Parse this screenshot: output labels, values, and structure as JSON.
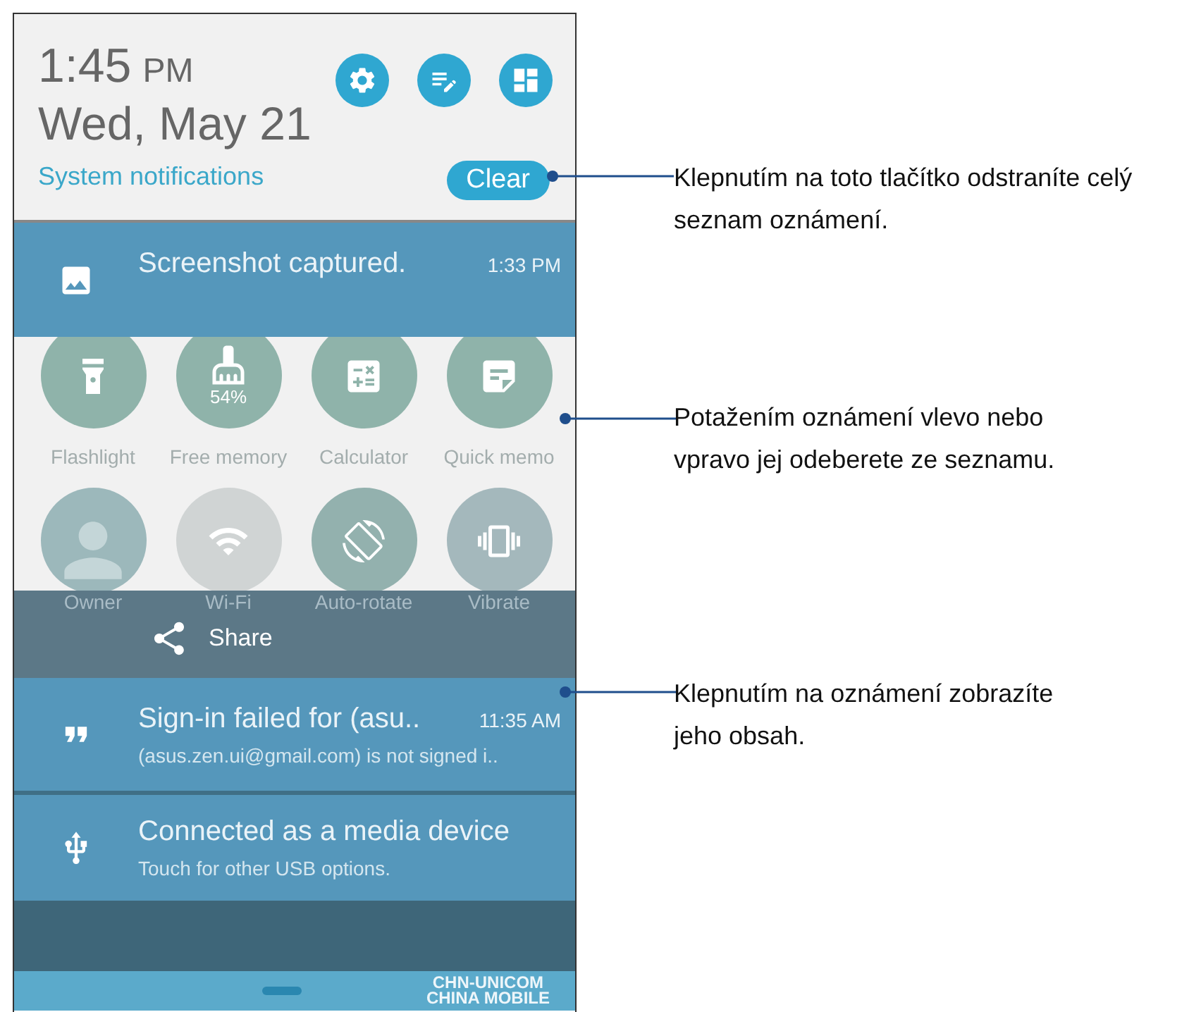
{
  "header": {
    "time": "1:45",
    "meridiem": "PM",
    "date": "Wed, May 21",
    "link": "System notifications",
    "clear_button": "Clear",
    "buttons": [
      {
        "kind": "settings"
      },
      {
        "kind": "edit"
      },
      {
        "kind": "grid"
      }
    ]
  },
  "top_notification": {
    "kind": "image",
    "title": "Screenshot captured.",
    "time": "1:33 PM"
  },
  "quick_settings": [
    {
      "kind": "flashlight",
      "label": "Flashlight",
      "on": true
    },
    {
      "kind": "memory",
      "label": "Free memory",
      "reading": "54%",
      "on": true
    },
    {
      "kind": "calculator",
      "label": "Calculator",
      "on": true
    },
    {
      "kind": "memo",
      "label": "Quick memo",
      "on": true
    },
    {
      "kind": "owner",
      "label": "Owner",
      "on": true
    },
    {
      "kind": "wifi",
      "label": "Wi-Fi",
      "on": false
    },
    {
      "kind": "rotate",
      "label": "Auto-rotate",
      "on": true
    },
    {
      "kind": "vibrate",
      "label": "Vibrate",
      "on": true
    }
  ],
  "share": {
    "label": "Share"
  },
  "notifications": [
    {
      "kind": "hangouts",
      "title": "Sign-in failed for (asu..",
      "time": "11:35 AM",
      "text": "(asus.zen.ui@gmail.com) is not signed i.."
    },
    {
      "kind": "usb",
      "title": "Connected as a media device",
      "text": "Touch for other USB options."
    }
  ],
  "carriers": [
    "CHN-UNICOM",
    "CHINA MOBILE"
  ],
  "callouts": [
    "Klepnutím na toto tlačítko odstraníte celý seznam oznámení.",
    "Potažením oznámení vlevo nebo vpravo jej odeberete ze seznamu.",
    "Klepnutím na oznámení zobrazíte jeho obsah."
  ]
}
